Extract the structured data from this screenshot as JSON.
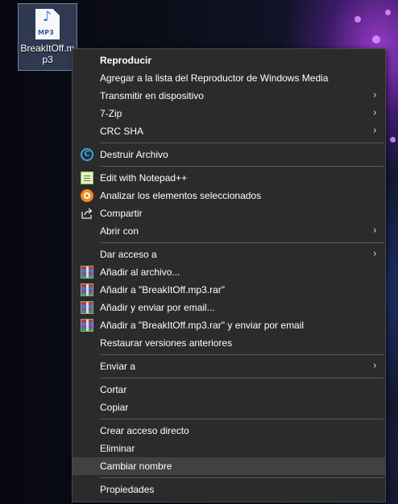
{
  "desktop": {
    "file_icon": {
      "label": "BreakItOff.mp3",
      "type_tag": "MP3",
      "icon": "mp3-file-icon"
    }
  },
  "menu": {
    "items": [
      {
        "label": "Reproducir",
        "bold": true
      },
      {
        "label": "Agregar a la lista del Reproductor de Windows Media"
      },
      {
        "label": "Transmitir en dispositivo",
        "submenu": true
      },
      {
        "label": "7-Zip",
        "submenu": true
      },
      {
        "label": "CRC SHA",
        "submenu": true
      },
      {
        "label": "Destruir Archivo",
        "icon": "destruir-archivo-icon"
      },
      {
        "label": "Edit with Notepad++",
        "icon": "notepad-plus-plus-icon"
      },
      {
        "label": "Analizar los elementos seleccionados",
        "icon": "avast-scan-icon"
      },
      {
        "label": "Compartir",
        "icon": "share-icon"
      },
      {
        "label": "Abrir con",
        "submenu": true
      },
      {
        "label": "Dar acceso a",
        "submenu": true
      },
      {
        "label": "Añadir al archivo...",
        "icon": "winrar-icon"
      },
      {
        "label": "Añadir a \"BreakItOff.mp3.rar\"",
        "icon": "winrar-icon"
      },
      {
        "label": "Añadir y enviar por email...",
        "icon": "winrar-icon"
      },
      {
        "label": "Añadir a \"BreakItOff.mp3.rar\" y enviar por email",
        "icon": "winrar-icon"
      },
      {
        "label": "Restaurar versiones anteriores"
      },
      {
        "label": "Enviar a",
        "submenu": true
      },
      {
        "label": "Cortar"
      },
      {
        "label": "Copiar"
      },
      {
        "label": "Crear acceso directo"
      },
      {
        "label": "Eliminar"
      },
      {
        "label": "Cambiar nombre",
        "hovered": true
      },
      {
        "label": "Propiedades"
      }
    ],
    "chevron_glyph": "›"
  },
  "colors": {
    "menu_background": "#2b2b2b",
    "menu_text": "#ffffff",
    "separator": "#5a5a5a",
    "hover_background": "#414141"
  }
}
